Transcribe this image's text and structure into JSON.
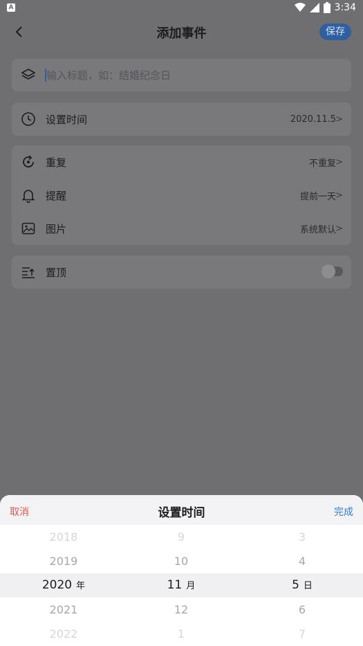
{
  "status": {
    "app_badge": "A",
    "time": "3:34",
    "battery_level": "3"
  },
  "header": {
    "title": "添加事件",
    "save_label": "保存"
  },
  "title_input": {
    "placeholder": "输入标题，如：结婚纪念日",
    "value": ""
  },
  "time_row": {
    "label": "设置时间",
    "value": "2020.11.5"
  },
  "options": [
    {
      "label": "重复",
      "value": "不重复"
    },
    {
      "label": "提醒",
      "value": "提前一天"
    },
    {
      "label": "图片",
      "value": "系统默认"
    }
  ],
  "pin_row": {
    "label": "置顶",
    "enabled": false
  },
  "chevron": ">",
  "sheet": {
    "cancel_label": "取消",
    "title": "设置时间",
    "done_label": "完成",
    "year": {
      "items": [
        "2018",
        "2019",
        "2020",
        "2021",
        "2022"
      ],
      "unit": "年",
      "selected": "2020"
    },
    "month": {
      "items": [
        "9",
        "10",
        "11",
        "12",
        "1"
      ],
      "unit": "月",
      "selected": "11"
    },
    "day": {
      "items": [
        "3",
        "4",
        "5",
        "6",
        "7"
      ],
      "unit": "日",
      "selected": "5"
    }
  },
  "colors": {
    "accent": "#2f5f9e",
    "cancel": "#e8524a",
    "done": "#2f7fd3"
  }
}
